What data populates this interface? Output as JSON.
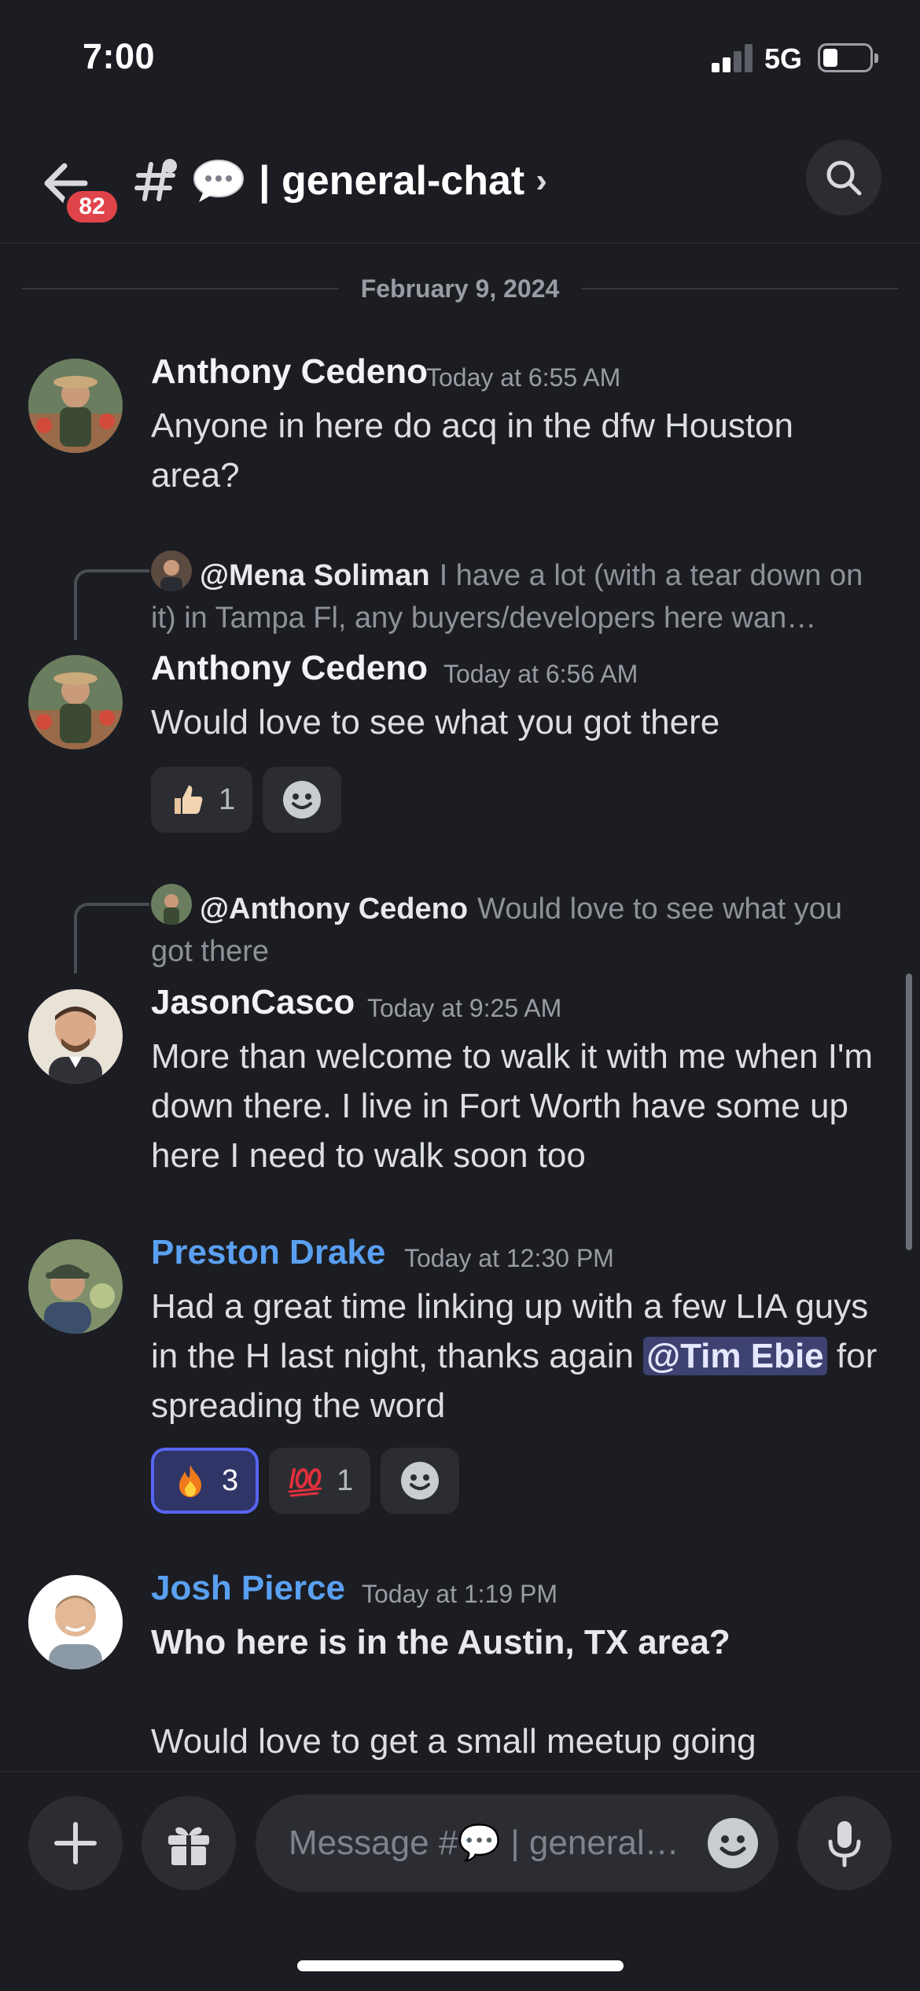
{
  "status_bar": {
    "time": "7:00",
    "network": "5G"
  },
  "header": {
    "unread_count": "82",
    "channel_name": "| general-chat",
    "chevron": "›"
  },
  "date_divider": "February 9, 2024",
  "messages": [
    {
      "author": "Anthony Cedeno",
      "timestamp": "Today at 6:55 AM",
      "text": "Anyone in here do acq in the dfw Houston area?"
    },
    {
      "reply_to": {
        "name": "@Mena Soliman",
        "preview": "I have a lot (with a tear down on it) in Tampa Fl, any buyers/developers here wan…"
      },
      "author": "Anthony Cedeno",
      "timestamp": "Today at 6:56 AM",
      "text": "Would love to see what you got there",
      "reactions": [
        {
          "emoji": "thumbs-up",
          "count": "1"
        }
      ]
    },
    {
      "reply_to": {
        "name": "@Anthony Cedeno",
        "preview": "Would love to see what you got there"
      },
      "author": "JasonCasco",
      "timestamp": "Today at 9:25 AM",
      "text": "More than welcome to walk it with me when I'm down there. I live in Fort Worth have some up here I need to walk soon too"
    },
    {
      "author": "Preston Drake",
      "author_color": "#5aa0f2",
      "timestamp": "Today at 12:30 PM",
      "text_before": "Had a great time linking up with a few LIA guys in the H last night, thanks again ",
      "mention": "@Tim Ebie",
      "text_after": " for spreading the word",
      "reactions": [
        {
          "emoji": "fire",
          "count": "3",
          "active": true
        },
        {
          "emoji": "hundred",
          "count": "1"
        }
      ]
    },
    {
      "author": "Josh Pierce",
      "author_color": "#5aa0f2",
      "timestamp": "Today at 1:19 PM",
      "text_bold": "Who here is in the Austin, TX area?",
      "text": "Would love to get a small meetup going"
    }
  ],
  "composer": {
    "placeholder": "Message #💬 | general…"
  },
  "icons": {
    "back": "arrow-left-icon",
    "channel": "hash-thread-icon",
    "search": "search-icon",
    "add": "plus-icon",
    "gift": "gift-icon",
    "emoji": "smiley-icon",
    "mic": "microphone-icon"
  },
  "colors": {
    "background": "#1c1d22",
    "accent": "#5865f2",
    "badge": "#e0444b",
    "role_blue": "#5aa0f2",
    "mention_bg": "#3d4270"
  }
}
